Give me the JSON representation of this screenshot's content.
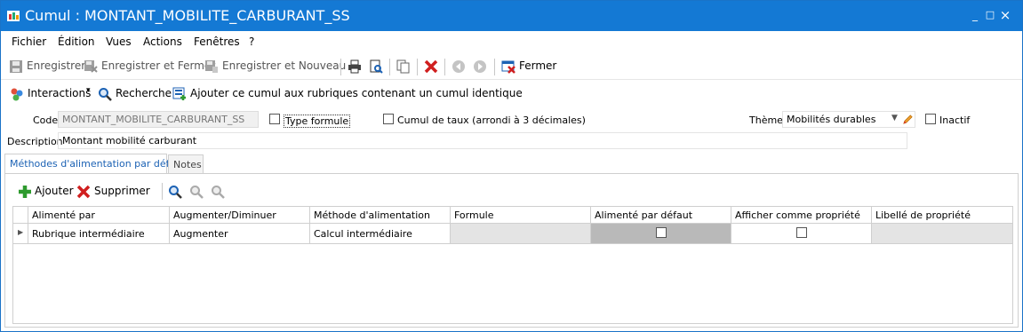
{
  "window": {
    "title": "Cumul : MONTANT_MOBILITE_CARBURANT_SS",
    "minimize": "_",
    "maximize": "□",
    "close": "×"
  },
  "menu": [
    "Fichier",
    "Édition",
    "Vues",
    "Actions",
    "Fenêtres",
    "?"
  ],
  "toolbar": {
    "save": "Enregistrer",
    "save_close": "Enregistrer et Fermer",
    "save_new": "Enregistrer et Nouveau",
    "close": "Fermer"
  },
  "toolbar2": {
    "interactions": "Interactions",
    "search": "Recherche",
    "add_cumul": "Ajouter ce cumul aux rubriques contenant un cumul identique"
  },
  "form": {
    "code_label": "Code",
    "code_value": "MONTANT_MOBILITE_CARBURANT_SS",
    "type_formule_label": "Type formule",
    "type_formule_checked": false,
    "cumul_taux_label": "Cumul de taux (arrondi à 3 décimales)",
    "cumul_taux_checked": false,
    "theme_label": "Thème",
    "theme_value": "Mobilités durables",
    "inactif_label": "Inactif",
    "inactif_checked": false,
    "description_label": "Description",
    "description_value": "Montant mobilité carburant"
  },
  "tabs": [
    {
      "label": "Méthodes d'alimentation par défaut",
      "active": true
    },
    {
      "label": "Notes",
      "active": false
    }
  ],
  "grid_toolbar": {
    "add": "Ajouter",
    "delete": "Supprimer"
  },
  "table": {
    "columns": [
      "Alimenté par",
      "Augmenter/Diminuer",
      "Méthode d'alimentation",
      "Formule",
      "Alimenté par défaut",
      "Afficher comme propriété",
      "Libellé de propriété"
    ],
    "rows": [
      {
        "alimente_par": "Rubrique intermédiaire",
        "augmenter": "Augmenter",
        "methode": "Calcul intermédiaire",
        "formule": "",
        "alimente_defaut": false,
        "afficher_propriete": false,
        "libelle": ""
      }
    ]
  },
  "colors": {
    "titlebar": "#1479d4",
    "accent": "#1c62b4",
    "delete": "#d01f1f",
    "add": "#2e9a2e"
  }
}
